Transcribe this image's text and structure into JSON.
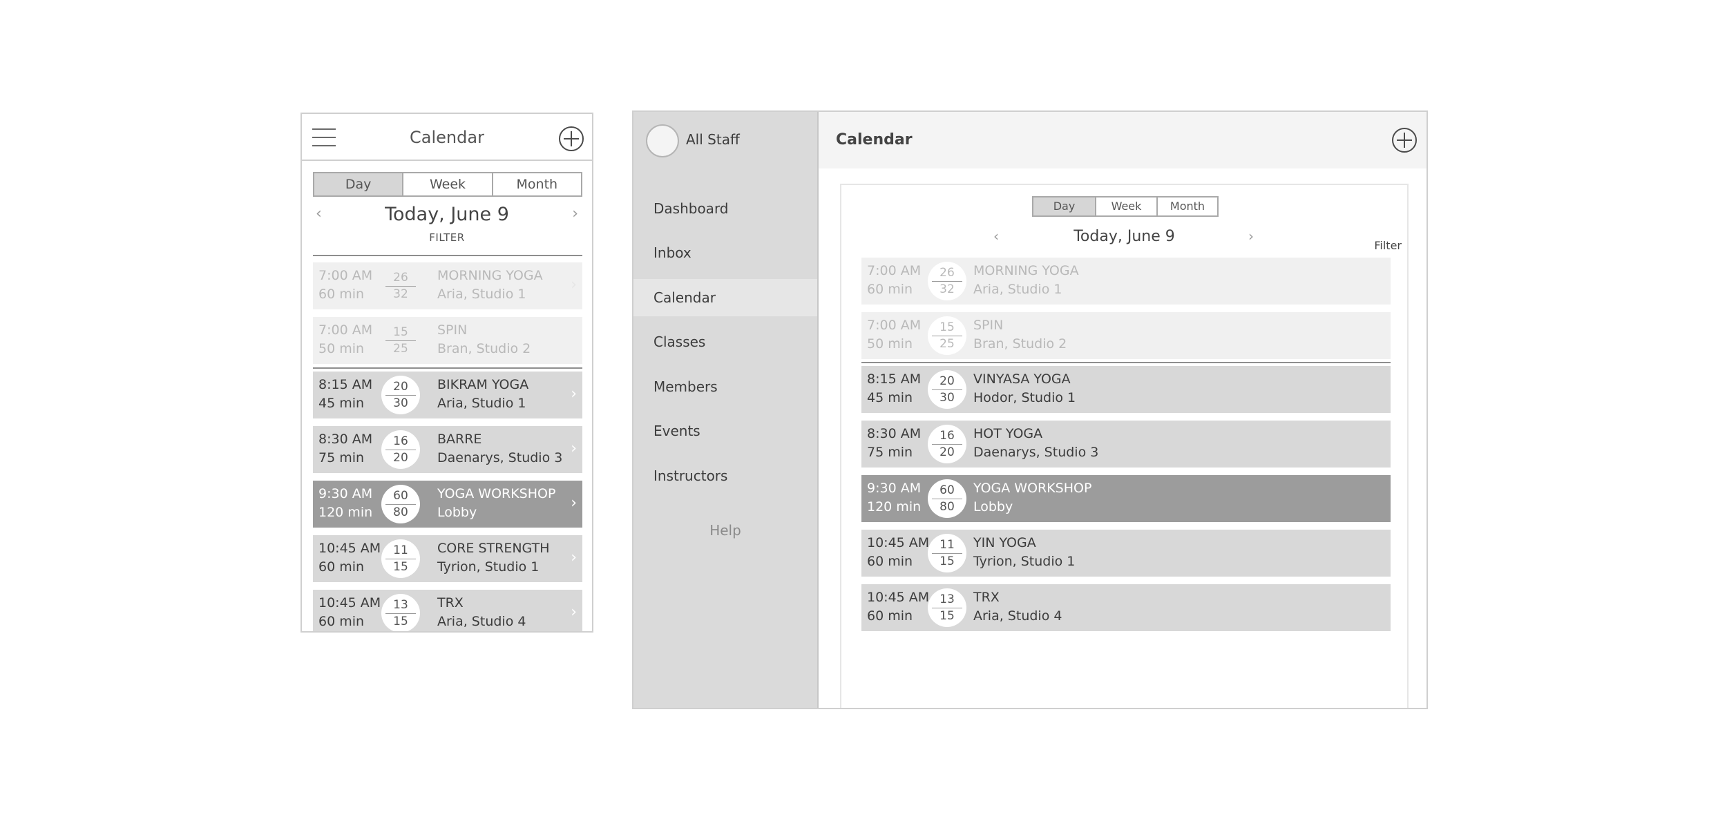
{
  "mobile": {
    "header": {
      "title": "Calendar"
    },
    "view_tabs": [
      "Day",
      "Week",
      "Month"
    ],
    "date_label": "Today, June 9",
    "filter_label": "FILTER",
    "classes": [
      {
        "time": "7:00 AM",
        "duration": "60 min",
        "booked": "26",
        "capacity": "32",
        "name": "MORNING YOGA",
        "location": "Aria, Studio 1",
        "state": "past"
      },
      {
        "time": "7:00 AM",
        "duration": "50 min",
        "booked": "15",
        "capacity": "25",
        "name": "SPIN",
        "location": "Bran, Studio 2",
        "state": "past"
      },
      {
        "time": "8:15 AM",
        "duration": "45 min",
        "booked": "20",
        "capacity": "30",
        "name": "BIKRAM YOGA",
        "location": "Aria, Studio 1",
        "state": "upcoming"
      },
      {
        "time": "8:30 AM",
        "duration": "75 min",
        "booked": "16",
        "capacity": "20",
        "name": "BARRE",
        "location": "Daenarys, Studio 3",
        "state": "upcoming"
      },
      {
        "time": "9:30 AM",
        "duration": "120 min",
        "booked": "60",
        "capacity": "80",
        "name": "YOGA WORKSHOP",
        "location": "Lobby",
        "state": "featured"
      },
      {
        "time": "10:45 AM",
        "duration": "60 min",
        "booked": "11",
        "capacity": "15",
        "name": "CORE STRENGTH",
        "location": "Tyrion, Studio 1",
        "state": "upcoming"
      },
      {
        "time": "10:45 AM",
        "duration": "60 min",
        "booked": "13",
        "capacity": "15",
        "name": "TRX",
        "location": "Aria, Studio 4",
        "state": "upcoming"
      }
    ]
  },
  "desktop": {
    "sidebar": {
      "staff_label": "All Staff",
      "nav": [
        "Dashboard",
        "Inbox",
        "Calendar",
        "Classes",
        "Members",
        "Events",
        "Instructors"
      ],
      "active_nav": "Calendar",
      "help_label": "Help"
    },
    "header": {
      "title": "Calendar"
    },
    "view_tabs": [
      "Day",
      "Week",
      "Month"
    ],
    "date_label": "Today, June 9",
    "filter_label": "Filter",
    "classes": [
      {
        "time": "7:00 AM",
        "duration": "60 min",
        "booked": "26",
        "capacity": "32",
        "name": "MORNING YOGA",
        "location": "Aria, Studio 1",
        "state": "past"
      },
      {
        "time": "7:00 AM",
        "duration": "50 min",
        "booked": "15",
        "capacity": "25",
        "name": "SPIN",
        "location": "Bran, Studio 2",
        "state": "past"
      },
      {
        "time": "8:15 AM",
        "duration": "45 min",
        "booked": "20",
        "capacity": "30",
        "name": "VINYASA YOGA",
        "location": "Hodor, Studio 1",
        "state": "upcoming"
      },
      {
        "time": "8:30 AM",
        "duration": "75 min",
        "booked": "16",
        "capacity": "20",
        "name": "HOT YOGA",
        "location": "Daenarys, Studio 3",
        "state": "upcoming"
      },
      {
        "time": "9:30 AM",
        "duration": "120 min",
        "booked": "60",
        "capacity": "80",
        "name": "YOGA WORKSHOP",
        "location": "Lobby",
        "state": "featured"
      },
      {
        "time": "10:45 AM",
        "duration": "60 min",
        "booked": "11",
        "capacity": "15",
        "name": "YIN YOGA",
        "location": "Tyrion, Studio 1",
        "state": "upcoming"
      },
      {
        "time": "10:45 AM",
        "duration": "60 min",
        "booked": "13",
        "capacity": "15",
        "name": "TRX",
        "location": "Aria, Studio 4",
        "state": "upcoming"
      }
    ]
  },
  "icons": {
    "menu": "hamburger-menu-icon",
    "add": "plus-circle-icon",
    "prev": "chevron-left-icon",
    "next": "chevron-right-icon",
    "avatar": "avatar-circle"
  },
  "colors": {
    "past_row": "#f0f0f0",
    "upcoming_row": "#d8d8d8",
    "featured_row": "#9c9c9c",
    "sidebar": "#dadada",
    "header_bg": "#f4f4f4"
  }
}
